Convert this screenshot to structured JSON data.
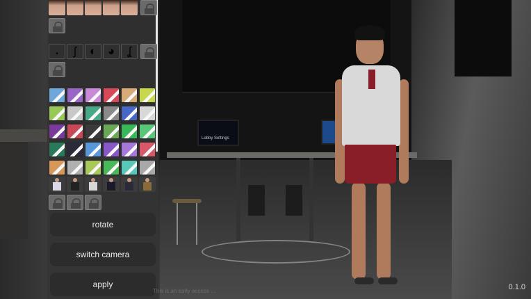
{
  "panel": {
    "faces": [
      "face-1",
      "face-2",
      "face-3",
      "face-4",
      "face-5"
    ],
    "hair_glyphs": [
      "𝆺",
      "ʃ",
      "◐",
      "◕",
      "ʆ"
    ],
    "outfit_colors": [
      [
        "#6ea7d8",
        "#9a64c8",
        "#c88ad8",
        "#d84858",
        "#d8aa78",
        "#c8d848"
      ],
      [
        "#98c858",
        "#c8c8c8",
        "#48a888",
        "#8a8a8a",
        "#4868c8",
        "#d8d8d8"
      ],
      [
        "#7a3a9a",
        "#c84858",
        "#3a3a3a",
        "#6aa858",
        "#38b858",
        "#58c878"
      ],
      [
        "#2a7a5a",
        "#2a2a3a",
        "#5898d8",
        "#8858c8",
        "#a878d8",
        "#d85868"
      ],
      [
        "#d89858",
        "#b0b0b0",
        "#a8c858",
        "#48b858",
        "#58c8b8",
        "#a8a8a8"
      ]
    ],
    "figure_colors": [
      "#d8d8e8",
      "#222222",
      "#d8d8d8",
      "#1a1a2a",
      "#2a2a3a",
      "#8a6a3a"
    ],
    "buttons": {
      "rotate": "rotate",
      "switch_camera": "switch camera",
      "apply": "apply"
    }
  },
  "scene": {
    "monitor_label": "Lobby Settings"
  },
  "footer": {
    "notice": "This is an early access …",
    "version": "0.1.0"
  }
}
